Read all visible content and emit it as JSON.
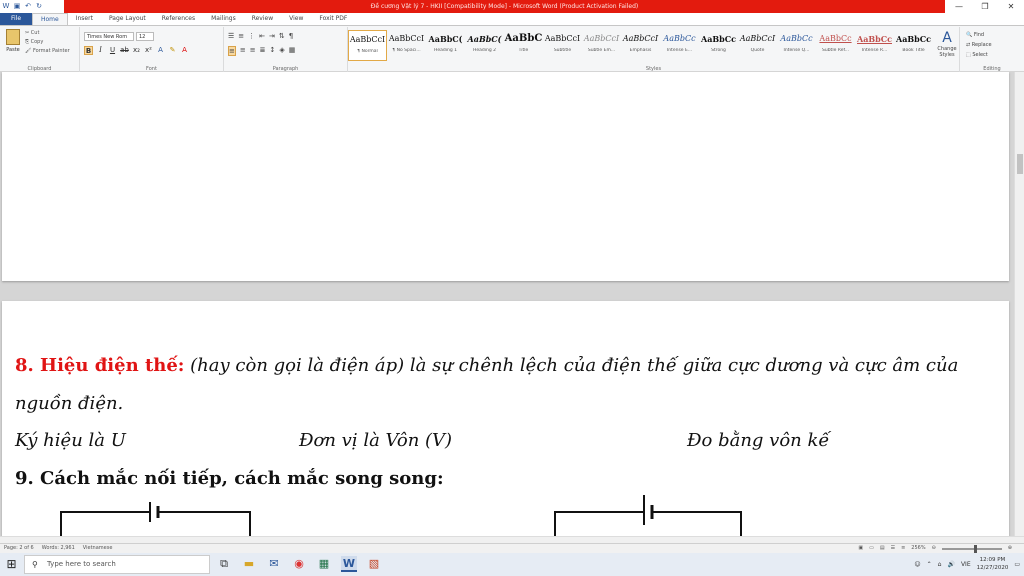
{
  "window": {
    "title": "Đề cương Vật lý 7 - HKII [Compatibility Mode] - Microsoft Word (Product Activation Failed)",
    "controls": [
      "—",
      "❐",
      "✕"
    ]
  },
  "tabs": [
    "File",
    "Home",
    "Insert",
    "Page Layout",
    "References",
    "Mailings",
    "Review",
    "View",
    "Foxit PDF"
  ],
  "ribbon": {
    "clipboard": {
      "paste": "Paste",
      "cut": "Cut",
      "copy": "Copy",
      "format_painter": "Format Painter",
      "label": "Clipboard"
    },
    "font": {
      "name": "Times New Rom",
      "size": "12",
      "label": "Font"
    },
    "paragraph": {
      "label": "Paragraph"
    },
    "styles": {
      "label": "Styles",
      "items": [
        {
          "preview": "AaBbCcI",
          "name": "¶ Normal"
        },
        {
          "preview": "AaBbCcI",
          "name": "¶ No Spaci..."
        },
        {
          "preview": "AaBbC(",
          "name": "Heading 1"
        },
        {
          "preview": "AaBbC(",
          "name": "Heading 2"
        },
        {
          "preview": "AaBbC",
          "name": "Title"
        },
        {
          "preview": "AaBbCcI",
          "name": "Subtitle"
        },
        {
          "preview": "AaBbCcI",
          "name": "Subtle Em..."
        },
        {
          "preview": "AaBbCcI",
          "name": "Emphasis"
        },
        {
          "preview": "AaBbCc",
          "name": "Intense E..."
        },
        {
          "preview": "AaBbCc",
          "name": "Strong"
        },
        {
          "preview": "AaBbCcI",
          "name": "Quote"
        },
        {
          "preview": "AaBbCc",
          "name": "Intense Q..."
        },
        {
          "preview": "AaBbCc",
          "name": "Subtle Ref..."
        },
        {
          "preview": "AaBbCc",
          "name": "Intense R..."
        },
        {
          "preview": "AaBbCc",
          "name": "Book Title"
        }
      ],
      "change_styles": "Change Styles"
    },
    "editing": {
      "find": "Find",
      "replace": "Replace",
      "select": "Select",
      "label": "Editing"
    }
  },
  "document": {
    "s8_heading": "8. Hiệu điện thế:",
    "s8_body": " (hay còn gọi là điện áp) là sự chênh lệch của điện thế giữa cực dương và cực âm của",
    "s8_body2": "nguồn điện.",
    "symbol": "Ký hiệu là U",
    "unit": "Đơn vị là Vôn  (V)",
    "measure": "Đo bằng vôn kế",
    "s9_heading": "9. Cách mắc nối tiếp, cách mắc song song:"
  },
  "status": {
    "page": "Page: 2 of 6",
    "words": "Words: 2,961",
    "language": "Vietnamese",
    "zoom": "256%"
  },
  "taskbar": {
    "search_placeholder": "Type here to search",
    "time": "12:09 PM",
    "date": "12/27/2020",
    "lang": "VIE"
  }
}
